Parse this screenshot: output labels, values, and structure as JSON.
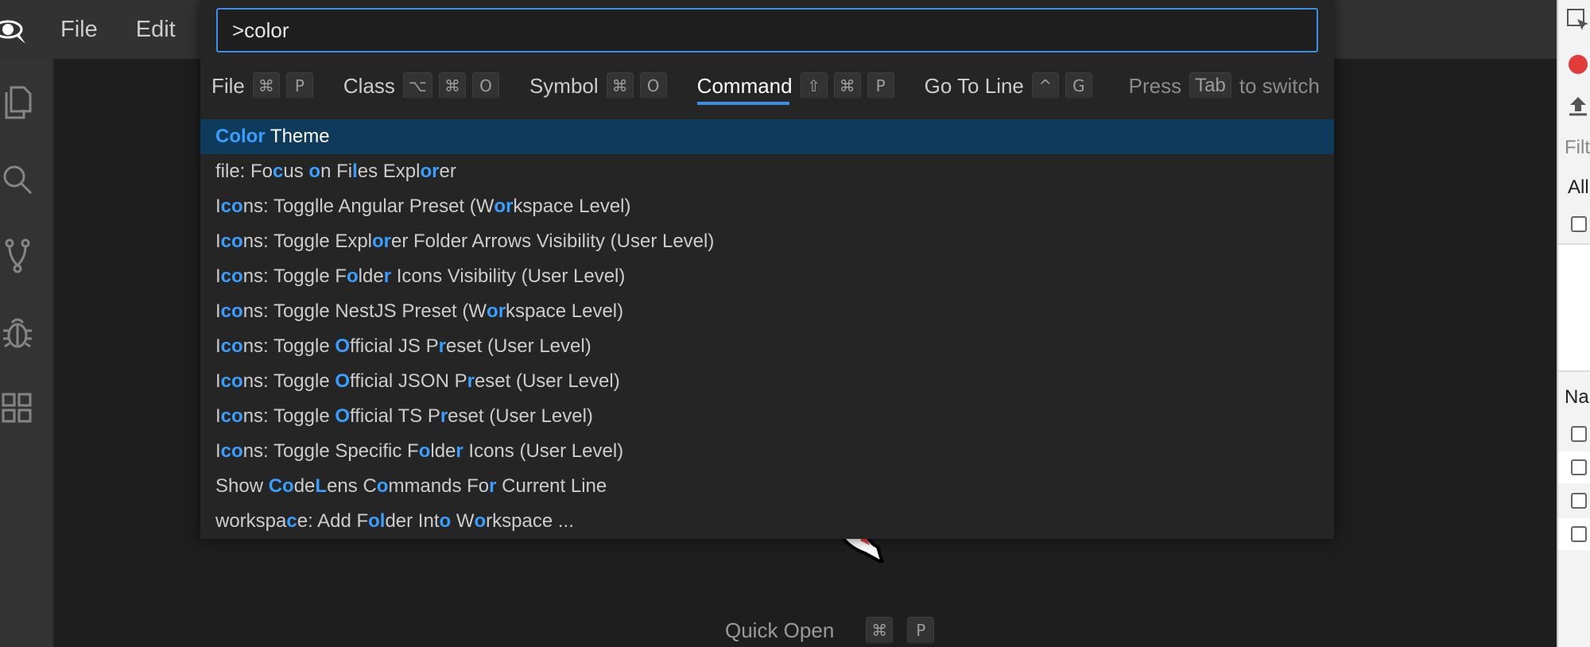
{
  "menubar": {
    "logo_icon": "spaceship-logo-icon",
    "items": [
      "File",
      "Edit"
    ]
  },
  "activitybar": {
    "icons": [
      "files-icon",
      "search-icon",
      "source-control-icon",
      "debug-icon",
      "extensions-icon"
    ]
  },
  "palette": {
    "input_value": ">color",
    "tabs": [
      {
        "label": "File",
        "keys": [
          "⌘",
          "P"
        ],
        "active": false
      },
      {
        "label": "Class",
        "keys": [
          "⌥",
          "⌘",
          "O"
        ],
        "active": false
      },
      {
        "label": "Symbol",
        "keys": [
          "⌘",
          "O"
        ],
        "active": false
      },
      {
        "label": "Command",
        "keys": [
          "⇧",
          "⌘",
          "P"
        ],
        "active": true
      },
      {
        "label": "Go To Line",
        "keys": [
          "^",
          "G"
        ],
        "active": false
      }
    ],
    "switch_hint": {
      "prefix": "Press",
      "key": "Tab",
      "suffix": "to switch"
    },
    "items": [
      {
        "segments": [
          {
            "t": "Color",
            "h": true
          },
          {
            "t": " Theme",
            "h": false
          }
        ],
        "selected": true
      },
      {
        "segments": [
          {
            "t": "file: Fo",
            "h": false
          },
          {
            "t": "c",
            "h": true
          },
          {
            "t": "us ",
            "h": false
          },
          {
            "t": "o",
            "h": true
          },
          {
            "t": "n Fi",
            "h": false
          },
          {
            "t": "l",
            "h": true
          },
          {
            "t": "es Expl",
            "h": false
          },
          {
            "t": "or",
            "h": true
          },
          {
            "t": "er",
            "h": false
          }
        ]
      },
      {
        "segments": [
          {
            "t": "I",
            "h": false
          },
          {
            "t": "co",
            "h": true
          },
          {
            "t": "ns: Toggl",
            "h": false
          },
          {
            "t": "l",
            "h": false
          },
          {
            "t": "e Angular Preset (W",
            "h": false
          },
          {
            "t": "or",
            "h": true
          },
          {
            "t": "kspace Level)",
            "h": false
          }
        ]
      },
      {
        "segments": [
          {
            "t": "I",
            "h": false
          },
          {
            "t": "co",
            "h": true
          },
          {
            "t": "ns: Toggl",
            "h": false
          },
          {
            "t": "e Expl",
            "h": false
          },
          {
            "t": "or",
            "h": true
          },
          {
            "t": "er Folder Arrows Visibility (User Level)",
            "h": false
          }
        ]
      },
      {
        "segments": [
          {
            "t": "I",
            "h": false
          },
          {
            "t": "co",
            "h": true
          },
          {
            "t": "ns: Toggl",
            "h": false
          },
          {
            "t": "e F",
            "h": false
          },
          {
            "t": "o",
            "h": true
          },
          {
            "t": "lde",
            "h": false
          },
          {
            "t": "r",
            "h": true
          },
          {
            "t": " Icons Visibility (User Level)",
            "h": false
          }
        ]
      },
      {
        "segments": [
          {
            "t": "I",
            "h": false
          },
          {
            "t": "co",
            "h": true
          },
          {
            "t": "ns: Toggl",
            "h": false
          },
          {
            "t": "e NestJS Preset (W",
            "h": false
          },
          {
            "t": "or",
            "h": true
          },
          {
            "t": "kspace Level)",
            "h": false
          }
        ]
      },
      {
        "segments": [
          {
            "t": "I",
            "h": false
          },
          {
            "t": "co",
            "h": true
          },
          {
            "t": "ns: Toggl",
            "h": false
          },
          {
            "t": "e ",
            "h": false
          },
          {
            "t": "O",
            "h": true
          },
          {
            "t": "fficial JS P",
            "h": false
          },
          {
            "t": "r",
            "h": true
          },
          {
            "t": "eset (User Level)",
            "h": false
          }
        ]
      },
      {
        "segments": [
          {
            "t": "I",
            "h": false
          },
          {
            "t": "co",
            "h": true
          },
          {
            "t": "ns: Toggl",
            "h": false
          },
          {
            "t": "e ",
            "h": false
          },
          {
            "t": "O",
            "h": true
          },
          {
            "t": "fficial JSON P",
            "h": false
          },
          {
            "t": "r",
            "h": true
          },
          {
            "t": "eset (User Level)",
            "h": false
          }
        ]
      },
      {
        "segments": [
          {
            "t": "I",
            "h": false
          },
          {
            "t": "co",
            "h": true
          },
          {
            "t": "ns: Toggl",
            "h": false
          },
          {
            "t": "e ",
            "h": false
          },
          {
            "t": "O",
            "h": true
          },
          {
            "t": "fficial TS P",
            "h": false
          },
          {
            "t": "r",
            "h": true
          },
          {
            "t": "eset (User Level)",
            "h": false
          }
        ]
      },
      {
        "segments": [
          {
            "t": "I",
            "h": false
          },
          {
            "t": "co",
            "h": true
          },
          {
            "t": "ns: Toggl",
            "h": false
          },
          {
            "t": "e Specific F",
            "h": false
          },
          {
            "t": "o",
            "h": true
          },
          {
            "t": "lde",
            "h": false
          },
          {
            "t": "r",
            "h": true
          },
          {
            "t": " Icons (User Level)",
            "h": false
          }
        ]
      },
      {
        "segments": [
          {
            "t": "Show ",
            "h": false
          },
          {
            "t": "Co",
            "h": true
          },
          {
            "t": "de",
            "h": false
          },
          {
            "t": "L",
            "h": true
          },
          {
            "t": "ens C",
            "h": false
          },
          {
            "t": "o",
            "h": true
          },
          {
            "t": "mmands Fo",
            "h": false
          },
          {
            "t": "r",
            "h": true
          },
          {
            "t": " Current Line",
            "h": false
          }
        ]
      },
      {
        "segments": [
          {
            "t": "workspa",
            "h": false
          },
          {
            "t": "c",
            "h": true
          },
          {
            "t": "e: Add F",
            "h": false
          },
          {
            "t": "ol",
            "h": true
          },
          {
            "t": "der Int",
            "h": false
          },
          {
            "t": "o",
            "h": true
          },
          {
            "t": " W",
            "h": false
          },
          {
            "t": "o",
            "h": true
          },
          {
            "t": "rkspace ...",
            "h": false
          }
        ]
      }
    ]
  },
  "editor": {
    "quick_open_label": "Quick Open",
    "quick_open_keys": [
      "⌘",
      "P"
    ]
  },
  "right_panel": {
    "filter_placeholder": "Filt",
    "all_label": "All",
    "name_header": "Na"
  },
  "colors": {
    "accent": "#3a8ee6",
    "highlight": "#3a9eff",
    "selected_row": "#0e3a5c"
  }
}
